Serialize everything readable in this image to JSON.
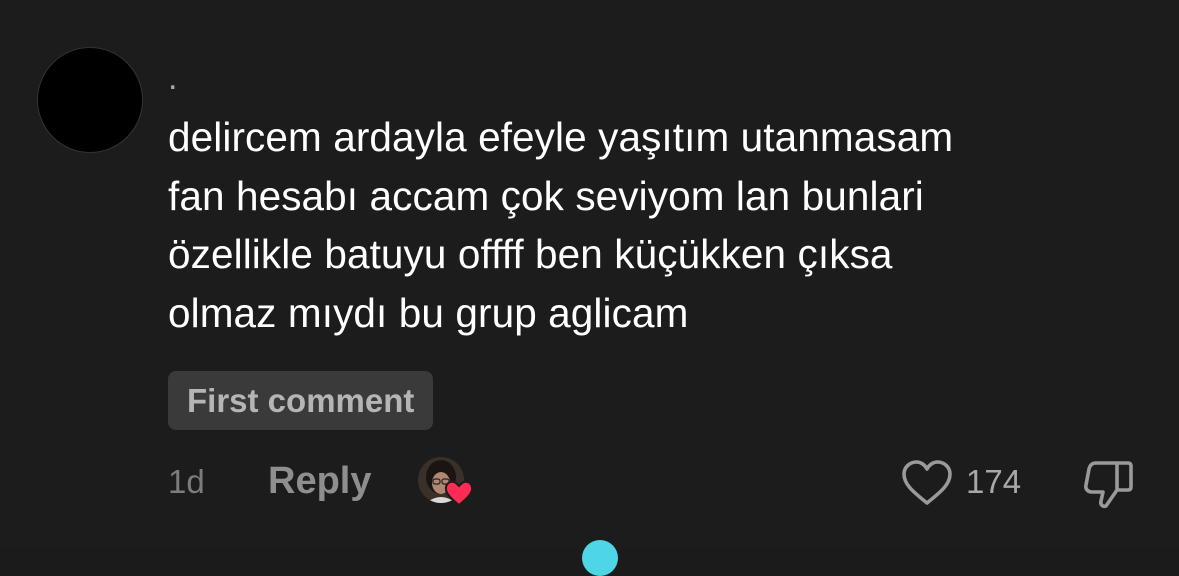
{
  "comment": {
    "username": ".",
    "text_lines": [
      "delircem ardayla efeyle yaşıtım utanmasam",
      "fan hesabı accam çok seviyom lan bunlari",
      "özellikle batuyu offff ben küçükken çıksa",
      "olmaz mıydı bu grup aglicam"
    ],
    "badge": "First comment",
    "timestamp": "1d",
    "reply_label": "Reply",
    "like_count": "174",
    "icons": {
      "like": "heart-outline-icon",
      "dislike": "thumbs-down-icon",
      "creator_like": "creator-liked-heart-icon"
    },
    "colors": {
      "background": "#1c1c1c",
      "text": "#ffffff",
      "muted": "#8e8e8e",
      "heart": "#fe2c55",
      "badge_bg": "#3a3a3a"
    }
  }
}
